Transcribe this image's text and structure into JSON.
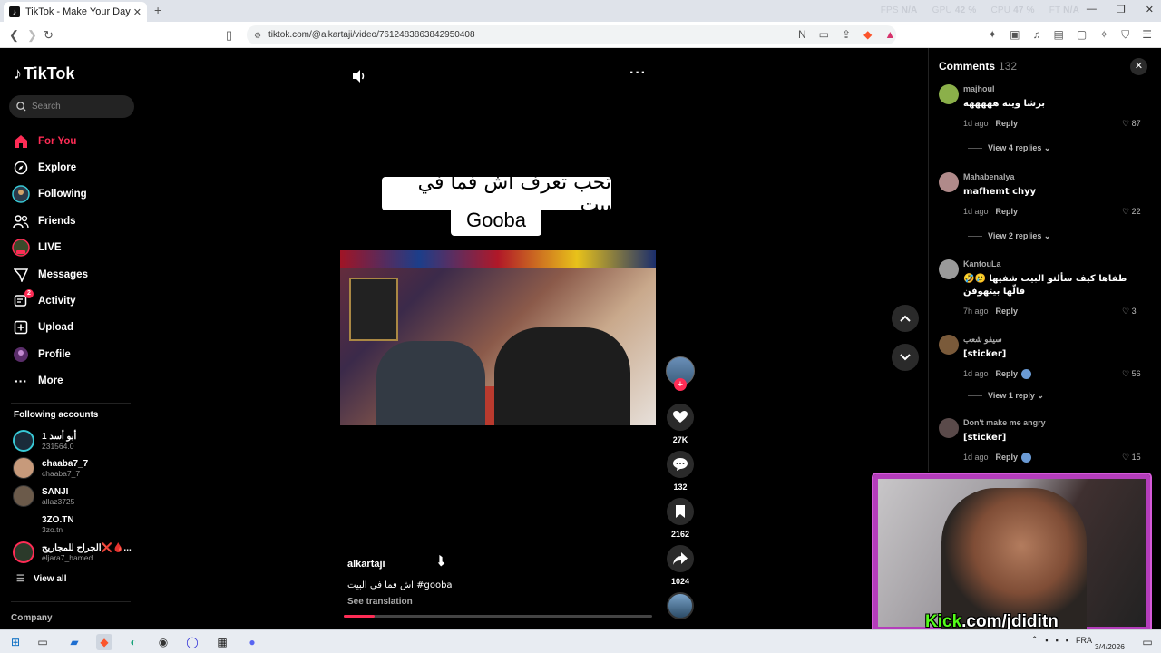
{
  "browser": {
    "tab_title": "TikTok - Make Your Day",
    "tab_close": "✕",
    "new_tab": "+",
    "url": "tiktok.com/@alkartaji/video/7612483863842950408",
    "stats": [
      {
        "label": "FPS",
        "value": "N/A"
      },
      {
        "label": "GPU",
        "value": "42 %"
      },
      {
        "label": "CPU",
        "value": "47 %"
      },
      {
        "label": "FT",
        "value": "N/A"
      }
    ]
  },
  "sidebar": {
    "logo": "TikTok",
    "search_placeholder": "Search",
    "menu": [
      {
        "label": "For You",
        "icon": "home-icon"
      },
      {
        "label": "Explore",
        "icon": "compass-icon"
      },
      {
        "label": "Following",
        "icon": "following-icon"
      },
      {
        "label": "Friends",
        "icon": "friends-icon"
      },
      {
        "label": "LIVE",
        "icon": "live-icon"
      },
      {
        "label": "Messages",
        "icon": "messages-icon"
      },
      {
        "label": "Activity",
        "icon": "activity-icon",
        "badge": "2"
      },
      {
        "label": "Upload",
        "icon": "upload-icon"
      },
      {
        "label": "Profile",
        "icon": "profile-icon"
      },
      {
        "label": "More",
        "icon": "more-icon"
      }
    ],
    "following_title": "Following accounts",
    "accounts": [
      {
        "name": "أبو أسد 1",
        "handle": "231564.0"
      },
      {
        "name": "chaaba7_7",
        "handle": "chaaba7_7"
      },
      {
        "name": "SANJI",
        "handle": "allaz3725"
      },
      {
        "name": "3ZO.TN",
        "handle": "3zo.tn"
      },
      {
        "name": "الجراح للمجاريح❌🩸...",
        "handle": "eljara7_hamed"
      }
    ],
    "view_all": "View all",
    "company": "Company"
  },
  "video": {
    "caption_line1": "تحب تعرف اش فما في بيت",
    "caption_line2": "Gooba",
    "creator": "alkartaji",
    "description": "اش فما في البيت #gooba",
    "see_translation": "See translation",
    "progress": 0.1,
    "likes": "27K",
    "comments": "132",
    "saves": "2162",
    "shares": "1024"
  },
  "comments": {
    "title": "Comments",
    "count": "132",
    "items": [
      {
        "user": "majhoul",
        "text": "برشا وينة هههههه",
        "time": "1d ago",
        "reply": "Reply",
        "likes": "87",
        "views": "View 4 replies"
      },
      {
        "user": "Mahabenalya",
        "text": "mafhemt chyy",
        "time": "1d ago",
        "reply": "Reply",
        "likes": "22",
        "views": "View 2 replies"
      },
      {
        "user": "KantouLa",
        "text": "طفاها كيف سألتو البيت شفيها 🥲🤣 قالّها بيتهوفن",
        "time": "7h ago",
        "reply": "Reply",
        "likes": "3",
        "views": ""
      },
      {
        "user": "سيفو شعب",
        "text": "[sticker]",
        "time": "1d ago",
        "reply": "Reply",
        "likes": "56",
        "views": "View 1 reply"
      },
      {
        "user": "Don't make me angry",
        "text": "[sticker]",
        "time": "1d ago",
        "reply": "Reply",
        "likes": "15",
        "views": ""
      }
    ]
  },
  "stream": {
    "label_prefix": "Kick",
    "label_rest": ".com/jdiditn"
  },
  "taskbar": {
    "lang": "FRA",
    "date": "3/4/2026"
  }
}
